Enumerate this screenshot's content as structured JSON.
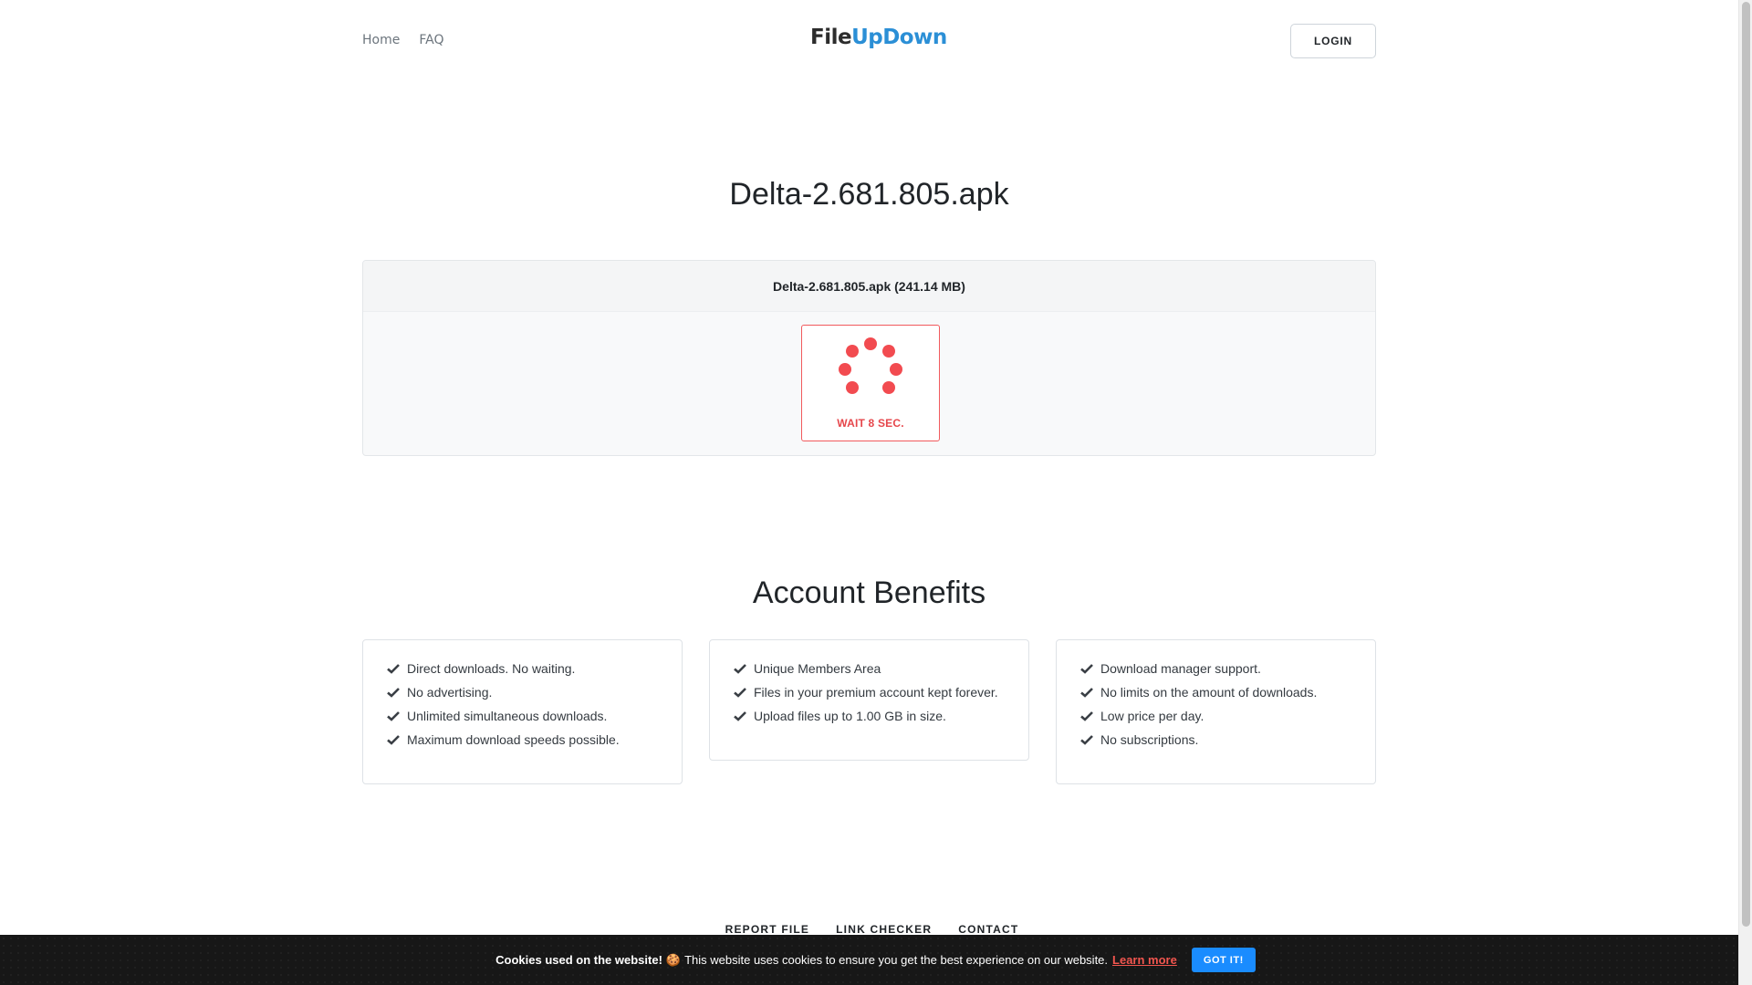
{
  "nav": {
    "home": "Home",
    "faq": "FAQ"
  },
  "logo": {
    "part1": "File",
    "part2": "UpDown",
    "color_dark": "#2c2c2c",
    "color_blue": "#2b8fd6"
  },
  "header": {
    "login_label": "LOGIN"
  },
  "file": {
    "title": "Delta-2.681.805.apk",
    "card_header": "Delta-2.681.805.apk (241.14 MB)",
    "wait_label": "WAIT 8 SEC.",
    "accent_color": "#f24b50"
  },
  "benefits": {
    "title": "Account Benefits",
    "col1": [
      "Direct downloads. No waiting.",
      "No advertising.",
      "Unlimited simultaneous downloads.",
      "Maximum download speeds possible."
    ],
    "col2": [
      "Unique Members Area",
      "Files in your premium account kept forever.",
      "Upload files up to 1.00 GB in size."
    ],
    "col3": [
      "Download manager support.",
      "No limits on the amount of downloads.",
      "Low price per day.",
      "No subscriptions."
    ]
  },
  "footer": {
    "report": "REPORT FILE",
    "checker": "LINK CHECKER",
    "contact": "CONTACT"
  },
  "cookie": {
    "bold_text": "Cookies used on the website!",
    "icon": "cookie-icon",
    "text": "This website uses cookies to ensure you get the best experience on our website.",
    "learn_more": "Learn more",
    "button": "GOT IT!"
  }
}
